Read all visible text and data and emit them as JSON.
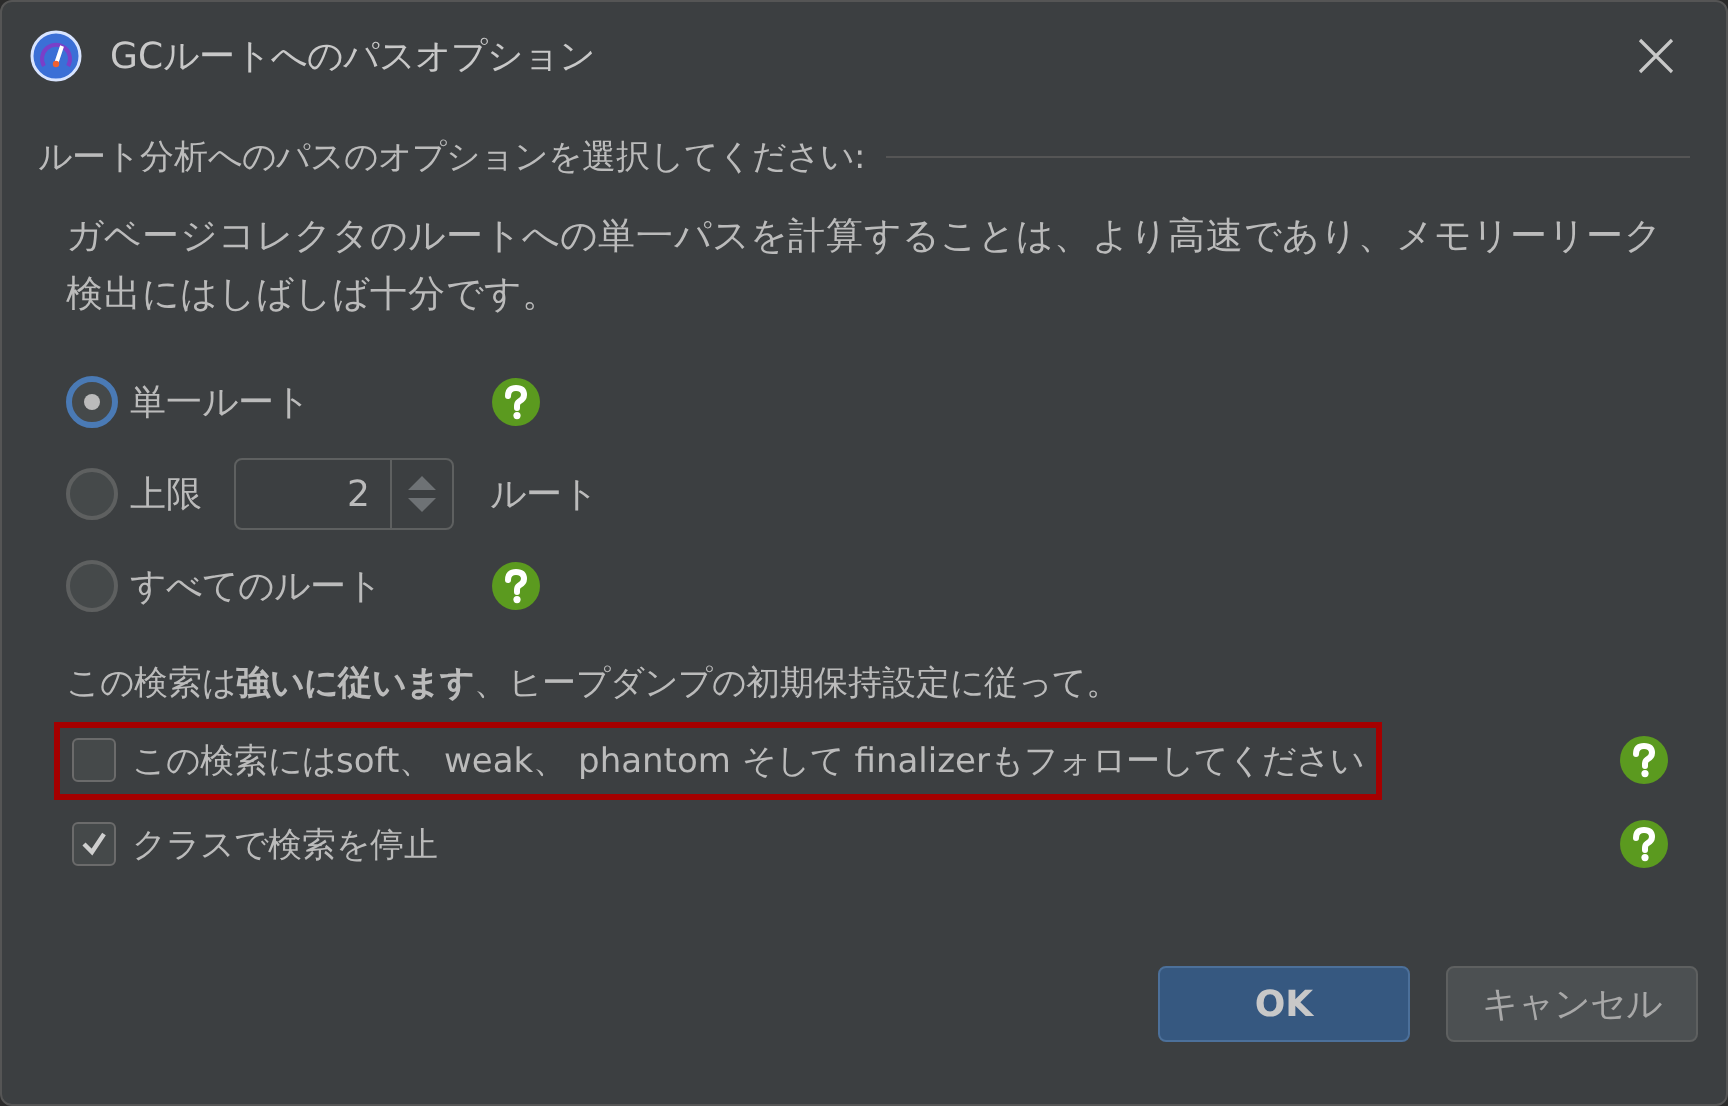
{
  "window": {
    "title": "GCルートへのパスオプション"
  },
  "section_label": "ルート分析へのパスのオプションを選択してください:",
  "description": "ガベージコレクタのルートへの単一パスを計算することは、より高速であり、メモリーリーク検出にはしばしば十分です。",
  "options": [
    {
      "kind": "plain",
      "label": "単一ルート",
      "selected": true,
      "help": true
    },
    {
      "kind": "limit",
      "label": "上限",
      "value": "2",
      "suffix": "ルート",
      "selected": false,
      "help": false
    },
    {
      "kind": "plain",
      "label": "すべてのルート",
      "selected": false,
      "help": true
    }
  ],
  "note": "この検索は**強いに従います**、ヒープダンプの初期保持設定に従って。",
  "checkboxes": [
    {
      "label": "この検索にはsoft、 weak、 phantom そして finalizerもフォローしてください",
      "checked": false,
      "highlighted": true
    },
    {
      "label": "クラスで検索を停止",
      "checked": true,
      "highlighted": false
    }
  ],
  "buttons": [
    {
      "label": "OK",
      "kind": "default"
    },
    {
      "label": "キャンセル",
      "kind": "normal"
    }
  ]
}
